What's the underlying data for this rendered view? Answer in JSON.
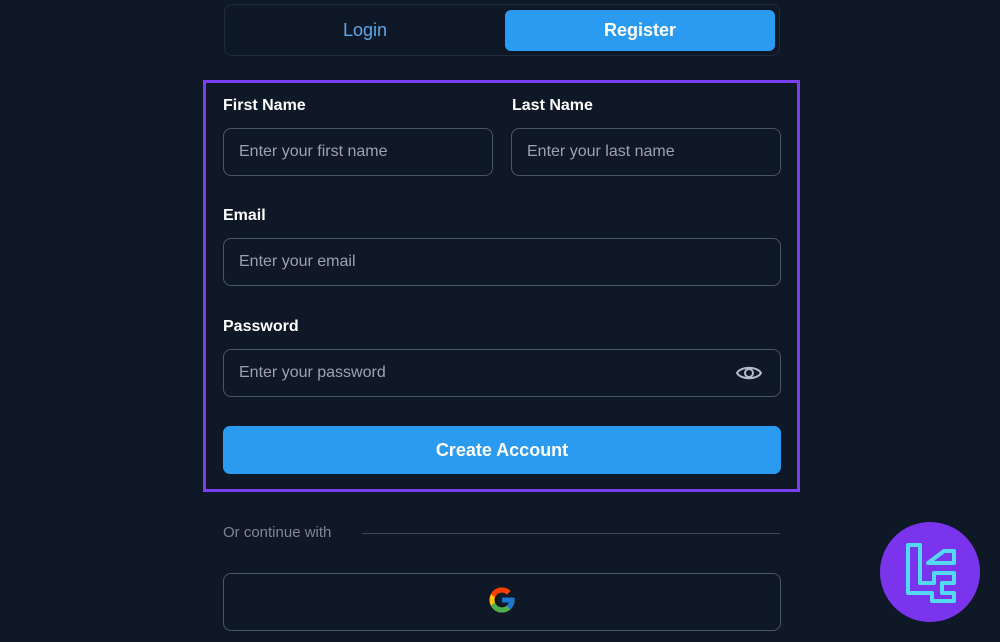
{
  "tabs": {
    "login": "Login",
    "register": "Register",
    "active": "register"
  },
  "form": {
    "first_name": {
      "label": "First Name",
      "placeholder": "Enter your first name",
      "value": ""
    },
    "last_name": {
      "label": "Last Name",
      "placeholder": "Enter your last name",
      "value": ""
    },
    "email": {
      "label": "Email",
      "placeholder": "Enter your email",
      "value": ""
    },
    "password": {
      "label": "Password",
      "placeholder": "Enter your password",
      "value": ""
    },
    "submit_label": "Create Account"
  },
  "social": {
    "divider_text": "Or continue with",
    "provider_icon": "google-icon"
  },
  "colors": {
    "accent": "#2a9bf0",
    "highlight": "#7b3ff2",
    "background": "#0f1826",
    "logo_bg": "#7a35ec"
  }
}
